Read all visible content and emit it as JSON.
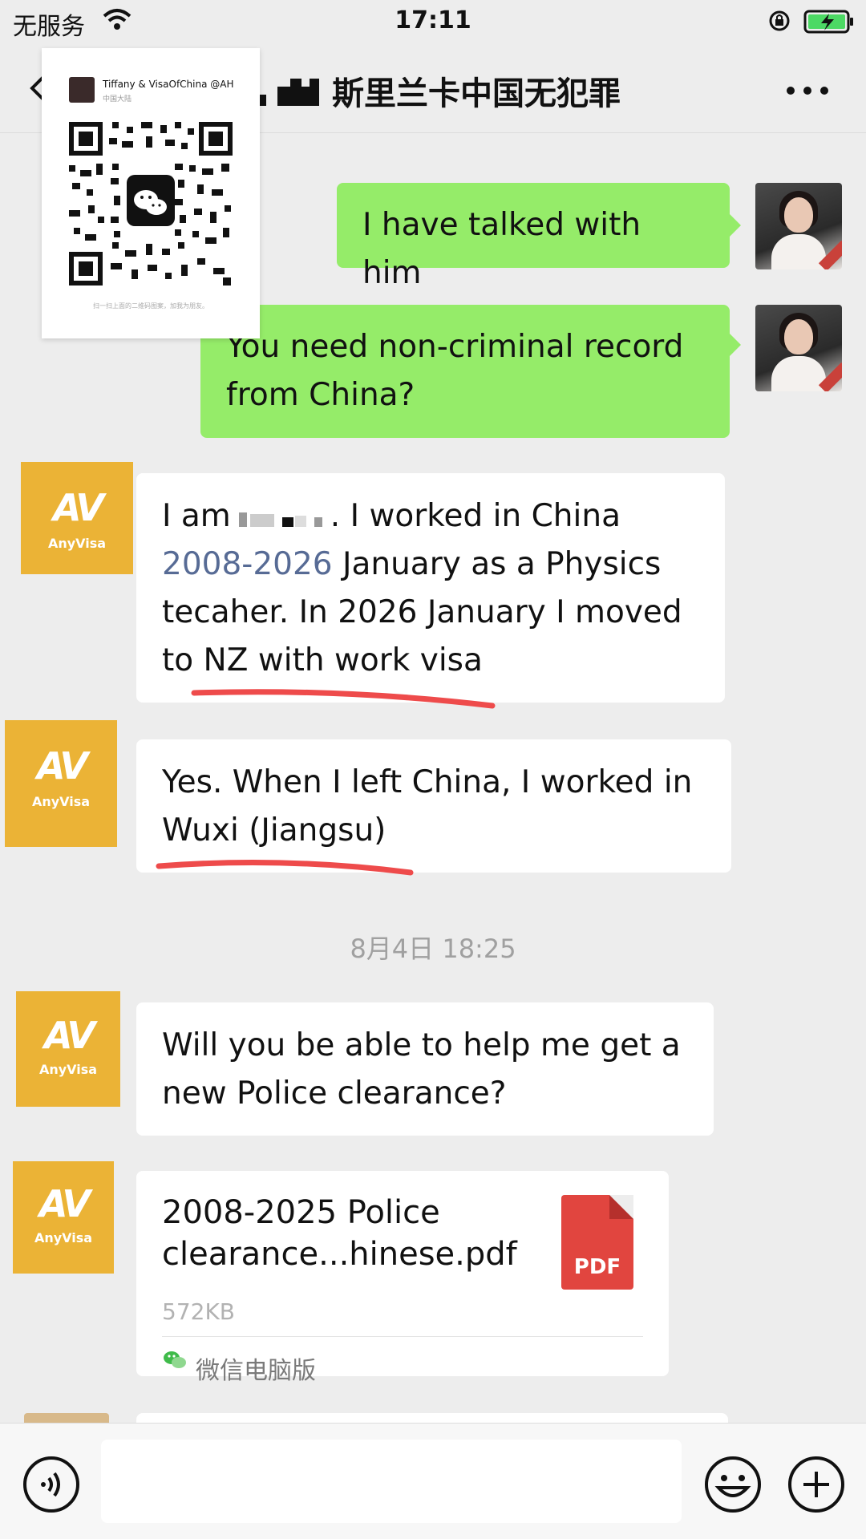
{
  "status_bar": {
    "carrier": "无服务",
    "time": "17:11"
  },
  "nav": {
    "title": "斯里兰卡中国无犯罪"
  },
  "qr_card": {
    "name": "Tiffany & VisaOfChina @AH",
    "region": "中国大陆",
    "caption": "扫一扫上面的二维码图案，加我为朋友。"
  },
  "messages": [
    {
      "side": "out",
      "text": "I have talked with him"
    },
    {
      "side": "out",
      "lines": [
        "You need non-criminal record",
        "from China?"
      ]
    },
    {
      "side": "in",
      "avatar": {
        "mark": "AV",
        "name": "AnyVisa"
      },
      "line1_prefix": "I am",
      "line1_suffix": ". I worked in China",
      "years": "2008-2026",
      "line2_rest": " January as a Physics",
      "line3": "tecaher. In 2026 January I moved",
      "line4": "to NZ with work visa"
    },
    {
      "side": "in",
      "avatar": {
        "mark": "AV",
        "name": "AnyVisa"
      },
      "lines": [
        "Yes. When I left China, I worked in",
        "Wuxi (Jiangsu)"
      ]
    },
    {
      "side": "in",
      "avatar": {
        "mark": "AV",
        "name": "AnyVisa"
      },
      "lines": [
        "Will you be able to help me get a",
        "new Police clearance?"
      ]
    },
    {
      "side": "in",
      "type": "file",
      "avatar": {
        "mark": "AV",
        "name": "AnyVisa"
      },
      "file_name_lines": [
        "2008-2025 Police",
        "clearance...hinese.pdf"
      ],
      "file_size": "572KB",
      "file_type": "PDF",
      "source": "微信电脑版"
    }
  ],
  "date_header": "8月4日 18:25",
  "input": {
    "placeholder": ""
  },
  "colors": {
    "outgoing_bubble": "#95ec69",
    "incoming_bubble": "#ffffff",
    "anyvisa_brand": "#ebb336",
    "link_blue": "#576b95",
    "pdf_red": "#e1453f",
    "annotation_red": "#ee4b4b"
  },
  "icons": [
    "wifi-icon",
    "rotation-lock-icon",
    "battery-charging-icon",
    "back-chevron-icon",
    "more-icon",
    "wechat-icon",
    "pdf-file-icon",
    "wechat-pc-icon",
    "voice-icon",
    "emoji-icon",
    "plus-icon"
  ]
}
